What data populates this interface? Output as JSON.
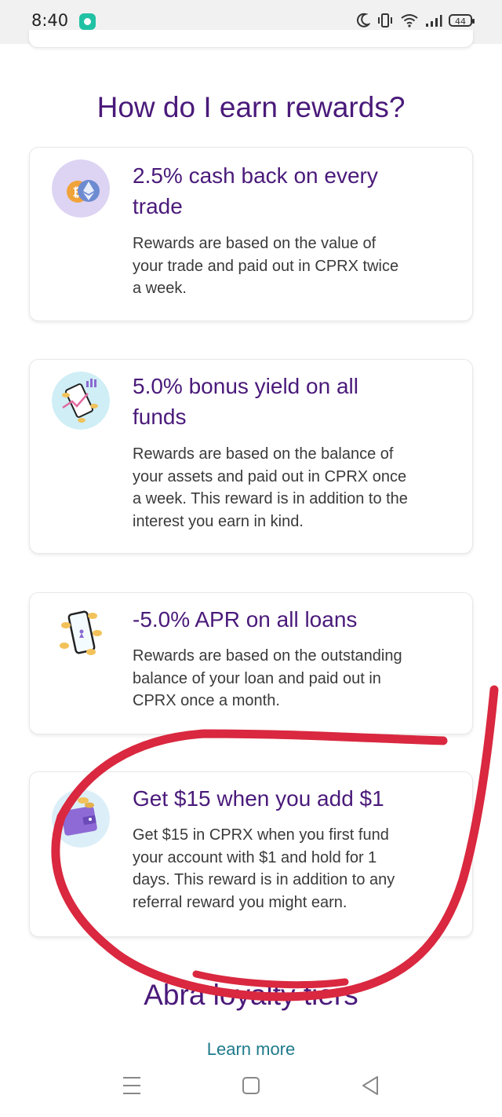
{
  "status_bar": {
    "time": "8:40",
    "battery": "44"
  },
  "section_title": "How do I earn rewards?",
  "cards": [
    {
      "icon": "crypto-coins-icon",
      "title_lines": [
        "2.5% cash back on every",
        "trade"
      ],
      "body_lines": [
        "Rewards are based on the value of",
        "your trade and paid out in CPRX twice",
        "a week."
      ]
    },
    {
      "icon": "phone-chart-icon",
      "title_lines": [
        "5.0% bonus yield on all",
        "funds"
      ],
      "body_lines": [
        "Rewards are based on the balance of",
        "your assets and paid out in CPRX once",
        "a week. This reward is in addition to the",
        "interest you earn in kind."
      ]
    },
    {
      "icon": "phone-coins-icon",
      "title_lines": [
        "-5.0% APR on all loans"
      ],
      "body_lines": [
        "Rewards are based on the outstanding",
        "balance of your loan and paid out in",
        "CPRX once a month."
      ]
    },
    {
      "icon": "wallet-icon",
      "title_lines": [
        "Get $15 when you add $1"
      ],
      "body_lines": [
        "Get $15 in CPRX when you first fund",
        "your account with $1 and hold for 1",
        "days. This reward is in addition to any",
        "referral reward you might earn."
      ]
    }
  ],
  "bottom_section_title": "Abra loyalty tiers",
  "learn_more": "Learn more",
  "colors": {
    "accent_purple": "#4a1a7a",
    "annotation_red": "#d9283f",
    "link_teal": "#1f7a8c"
  }
}
